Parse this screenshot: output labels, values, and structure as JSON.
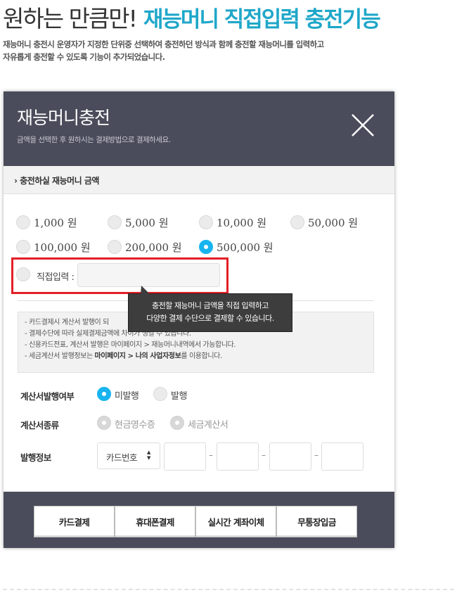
{
  "headline": {
    "light": "원하는 만큼만!",
    "strong": "재능머니 직접입력 충전기능"
  },
  "intro": {
    "line1": "재능머니 충전시 운영자가 지정한 단위중 선택하여 충전하던 방식과 함께 충전할 재능머니를 입력하고",
    "line2": "자유롭게 충전할 수 있도록 기능이 추가되었습니다."
  },
  "modal": {
    "title": "재능머니충전",
    "subtitle": "금액을 선택한 후 원하시는 결제방법으로 결제하세요.",
    "section_label": "충전하실 재능머니 금액",
    "amounts": [
      "1,000 원",
      "5,000 원",
      "10,000 원",
      "50,000 원",
      "100,000 원",
      "200,000 원",
      "500,000 원"
    ],
    "selected_amount": "500,000 원",
    "direct_label": "직접입력 :",
    "direct_value": "",
    "tooltip": {
      "line1": "충전할 재능머니 금액을 직접 입력하고",
      "line2": "다양한 결제 수단으로 결제할 수 있습니다."
    },
    "notices": [
      {
        "prefix": "- 카드결제시 계산서 발행이 되",
        "bold": "",
        "suffix": ""
      },
      {
        "prefix": "- 결제수단에 따라 실제결제금액에 차이가 생길 수 있습니다.",
        "bold": "",
        "suffix": ""
      },
      {
        "prefix": "- 신용카드전표, 계산서 발행은 마이페이지 > 재능머니내역에서 가능합니다.",
        "bold": "",
        "suffix": ""
      },
      {
        "prefix": "- 세금계산서 발행정보는 ",
        "bold": "마이페이지 > 나의 사업자정보",
        "suffix": "를 이용합니다."
      }
    ],
    "invoice_issue": {
      "label": "계산서발행여부",
      "options": [
        "미발행",
        "발행"
      ],
      "selected": "미발행"
    },
    "invoice_type": {
      "label": "계산서종류",
      "options": [
        "현금영수증",
        "세금계산서"
      ]
    },
    "issue_info": {
      "label": "발행정보",
      "select_value": "카드번호"
    },
    "pay_buttons": [
      "카드결제",
      "휴대폰결제",
      "실시간 계좌이체",
      "무통장입금"
    ]
  },
  "colors": {
    "accent": "#1fa7c9",
    "radio_selected": "#18b4ef",
    "header_bg": "#4a4c5b",
    "highlight_border": "#e41e26"
  }
}
